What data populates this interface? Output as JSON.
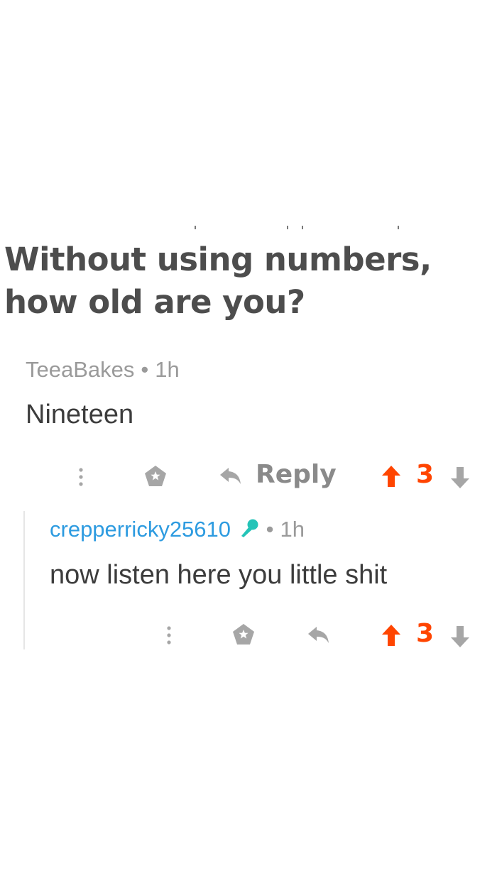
{
  "post": {
    "title": "Without using numbers, how old are you?"
  },
  "comment": {
    "author": "TeeaBakes",
    "separator": "•",
    "age": "1h",
    "body": "Nineteen",
    "reply_label": "Reply",
    "score": "3"
  },
  "reply": {
    "author": "crepperricky25610",
    "separator": "•",
    "age": "1h",
    "body": "now listen here you little shit",
    "score": "3",
    "flair_icon": "microphone-icon"
  },
  "colors": {
    "upvote": "#ff4500",
    "username_link": "#2d9be0",
    "flair": "#24c4b8",
    "icon_gray": "#9a9a9a"
  }
}
